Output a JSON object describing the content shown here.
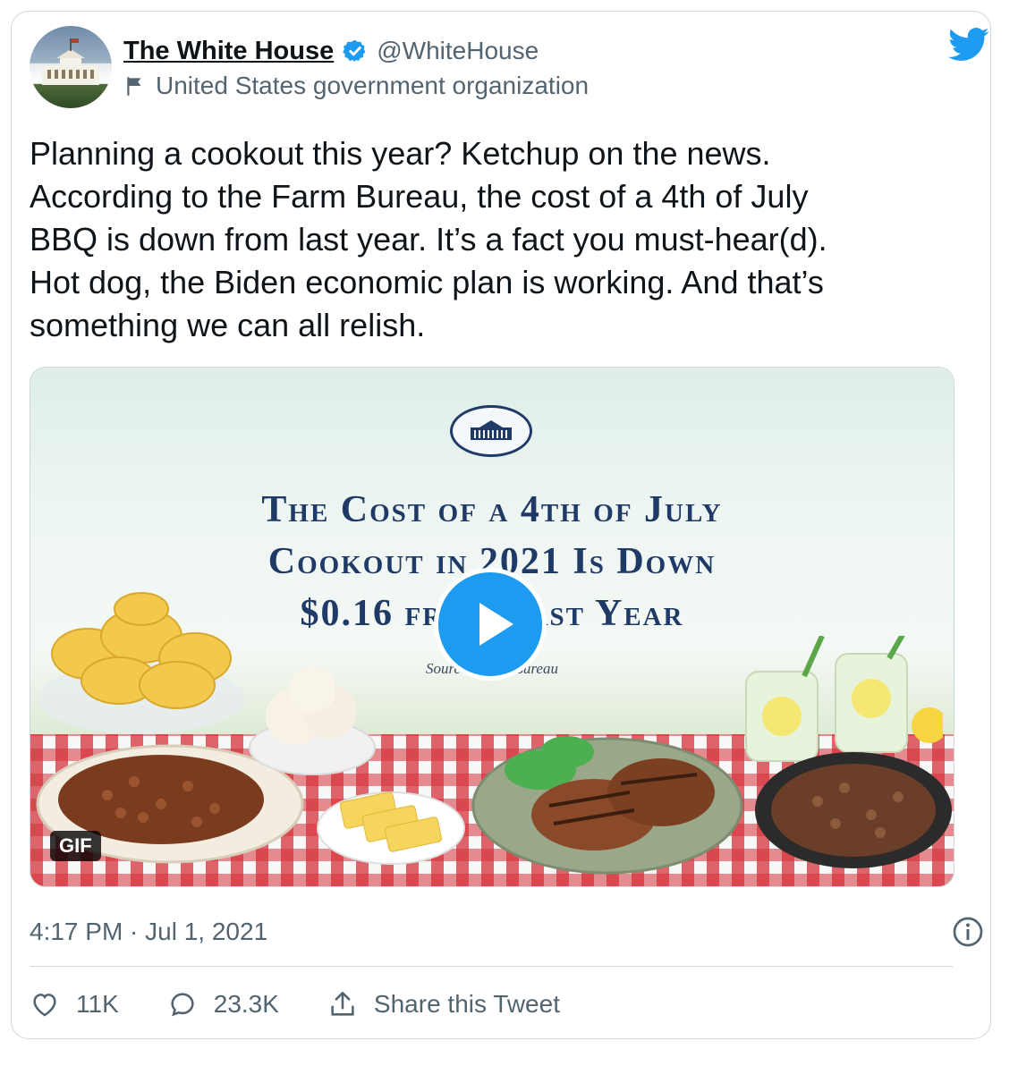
{
  "author": {
    "name": "The White House",
    "handle": "@WhiteHouse",
    "label": "United States government organization"
  },
  "tweet": {
    "text": "Planning a cookout this year? Ketchup on the news.\nAccording to the Farm Bureau, the cost of a 4th of July\nBBQ is down from last year. It’s a fact you must-hear(d).\nHot dog, the Biden economic plan is working. And that’s\nsomething we can all relish."
  },
  "media": {
    "headline_line1": "The Cost of a 4th of July",
    "headline_line2": "Cookout in 2021 Is Down",
    "headline_line3": "$0.16 from Last Year",
    "source": "Source: Farm Bureau",
    "badge": "GIF"
  },
  "meta": {
    "timestamp": "4:17 PM · Jul 1, 2021"
  },
  "actions": {
    "likes": "11K",
    "replies": "23.3K",
    "share_label": "Share this Tweet"
  },
  "colors": {
    "accent": "#1d9bf0",
    "text": "#0f1419",
    "secondary": "#536471",
    "headline": "#1f3a67"
  },
  "icons": [
    "verified-badge-icon",
    "flag-icon",
    "twitter-bird-icon",
    "play-icon",
    "info-icon",
    "heart-icon",
    "reply-icon",
    "share-icon"
  ]
}
